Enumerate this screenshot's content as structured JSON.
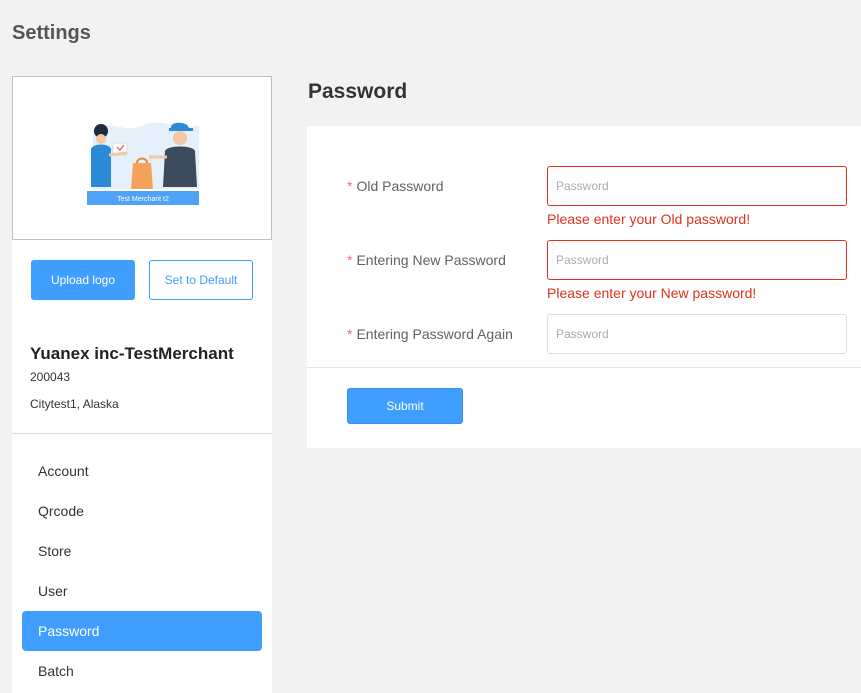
{
  "page": {
    "title": "Settings"
  },
  "profile": {
    "logo_caption": "Test Merchant t2",
    "upload_label": "Upload logo",
    "default_label": "Set to Default",
    "merchant_name": "Yuanex inc-TestMerchant",
    "merchant_code": "200043",
    "merchant_location": "Citytest1, Alaska"
  },
  "menu": {
    "items": [
      {
        "label": "Account",
        "active": false
      },
      {
        "label": "Qrcode",
        "active": false
      },
      {
        "label": "Store",
        "active": false
      },
      {
        "label": "User",
        "active": false
      },
      {
        "label": "Password",
        "active": true
      },
      {
        "label": "Batch",
        "active": false
      }
    ]
  },
  "form": {
    "section_title": "Password",
    "required_mark": "*",
    "fields": [
      {
        "label": "Old Password",
        "placeholder": "Password",
        "value": "",
        "error": "Please enter your Old password!"
      },
      {
        "label": "Entering New Password",
        "placeholder": "Password",
        "value": "",
        "error": "Please enter your New password!"
      },
      {
        "label": "Entering Password Again",
        "placeholder": "Password",
        "value": "",
        "error": ""
      }
    ],
    "submit_label": "Submit"
  },
  "colors": {
    "accent": "#409eff",
    "error": "#e0321c",
    "required": "#f56c6c"
  }
}
